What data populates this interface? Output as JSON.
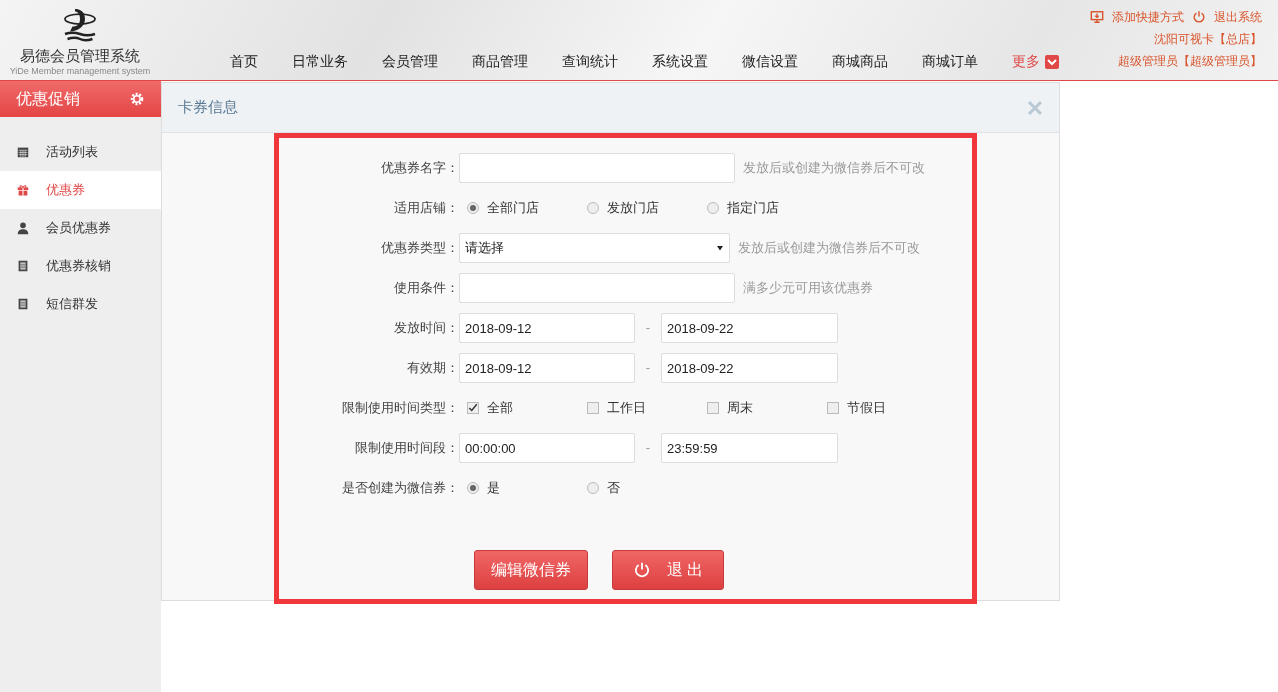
{
  "header": {
    "logo_title": "易德会员管理系统",
    "logo_subtitle": "YiDe Member management system",
    "nav": [
      {
        "label": "首页",
        "kind": "plain"
      },
      {
        "label": "日常业务",
        "kind": "plain"
      },
      {
        "label": "会员管理",
        "kind": "plain"
      },
      {
        "label": "商品管理",
        "kind": "plain"
      },
      {
        "label": "查询统计",
        "kind": "plain"
      },
      {
        "label": "系统设置",
        "kind": "plain"
      },
      {
        "label": "微信设置",
        "kind": "plain"
      },
      {
        "label": "商城商品",
        "kind": "plain"
      },
      {
        "label": "商城订单",
        "kind": "plain"
      },
      {
        "label": "更多",
        "kind": "more"
      }
    ],
    "links": [
      {
        "label": "添加快捷方式"
      },
      {
        "label": "退出系统"
      }
    ],
    "store": "沈阳可视卡【总店】",
    "user": "超级管理员【超级管理员】"
  },
  "sidebar": {
    "title": "优惠促销",
    "items": [
      {
        "label": "活动列表",
        "selected": false
      },
      {
        "label": "优惠券",
        "selected": true
      },
      {
        "label": "会员优惠券",
        "selected": false
      },
      {
        "label": "优惠券核销",
        "selected": false
      },
      {
        "label": "短信群发",
        "selected": false
      }
    ]
  },
  "panel": {
    "title": "卡券信息",
    "fields": [
      {
        "kind": "text",
        "label": "优惠券名字：",
        "hint": "发放后或创建为微信券后不可改"
      },
      {
        "kind": "radio",
        "label": "适用店铺：",
        "options": [
          {
            "label": "全部门店",
            "selected": true
          },
          {
            "label": "发放门店",
            "selected": false
          },
          {
            "label": "指定门店",
            "selected": false
          }
        ]
      },
      {
        "kind": "select",
        "label": "优惠券类型：",
        "value": "请选择",
        "hint": "发放后或创建为微信券后不可改"
      },
      {
        "kind": "text",
        "label": "使用条件：",
        "hint": "满多少元可用该优惠券"
      },
      {
        "kind": "range",
        "label": "发放时间：",
        "from": "2018-09-12",
        "separator": "-",
        "to": "2018-09-22"
      },
      {
        "kind": "range",
        "label": "有效期：",
        "from": "2018-09-12",
        "separator": "-",
        "to": "2018-09-22"
      },
      {
        "kind": "checks",
        "label": "限制使用时间类型：",
        "options": [
          {
            "label": "全部",
            "checked": true
          },
          {
            "label": "工作日",
            "checked": false
          },
          {
            "label": "周末",
            "checked": false
          },
          {
            "label": "节假日",
            "checked": false
          }
        ]
      },
      {
        "kind": "range",
        "label": "限制使用时间段：",
        "from": "00:00:00",
        "separator": "-",
        "to": "23:59:59"
      },
      {
        "kind": "radio",
        "label": "是否创建为微信券：",
        "options": [
          {
            "label": "是",
            "selected": true
          },
          {
            "label": "否",
            "selected": false
          }
        ]
      }
    ],
    "buttons": [
      {
        "label": "编辑微信券"
      },
      {
        "label": "退 出"
      }
    ]
  }
}
